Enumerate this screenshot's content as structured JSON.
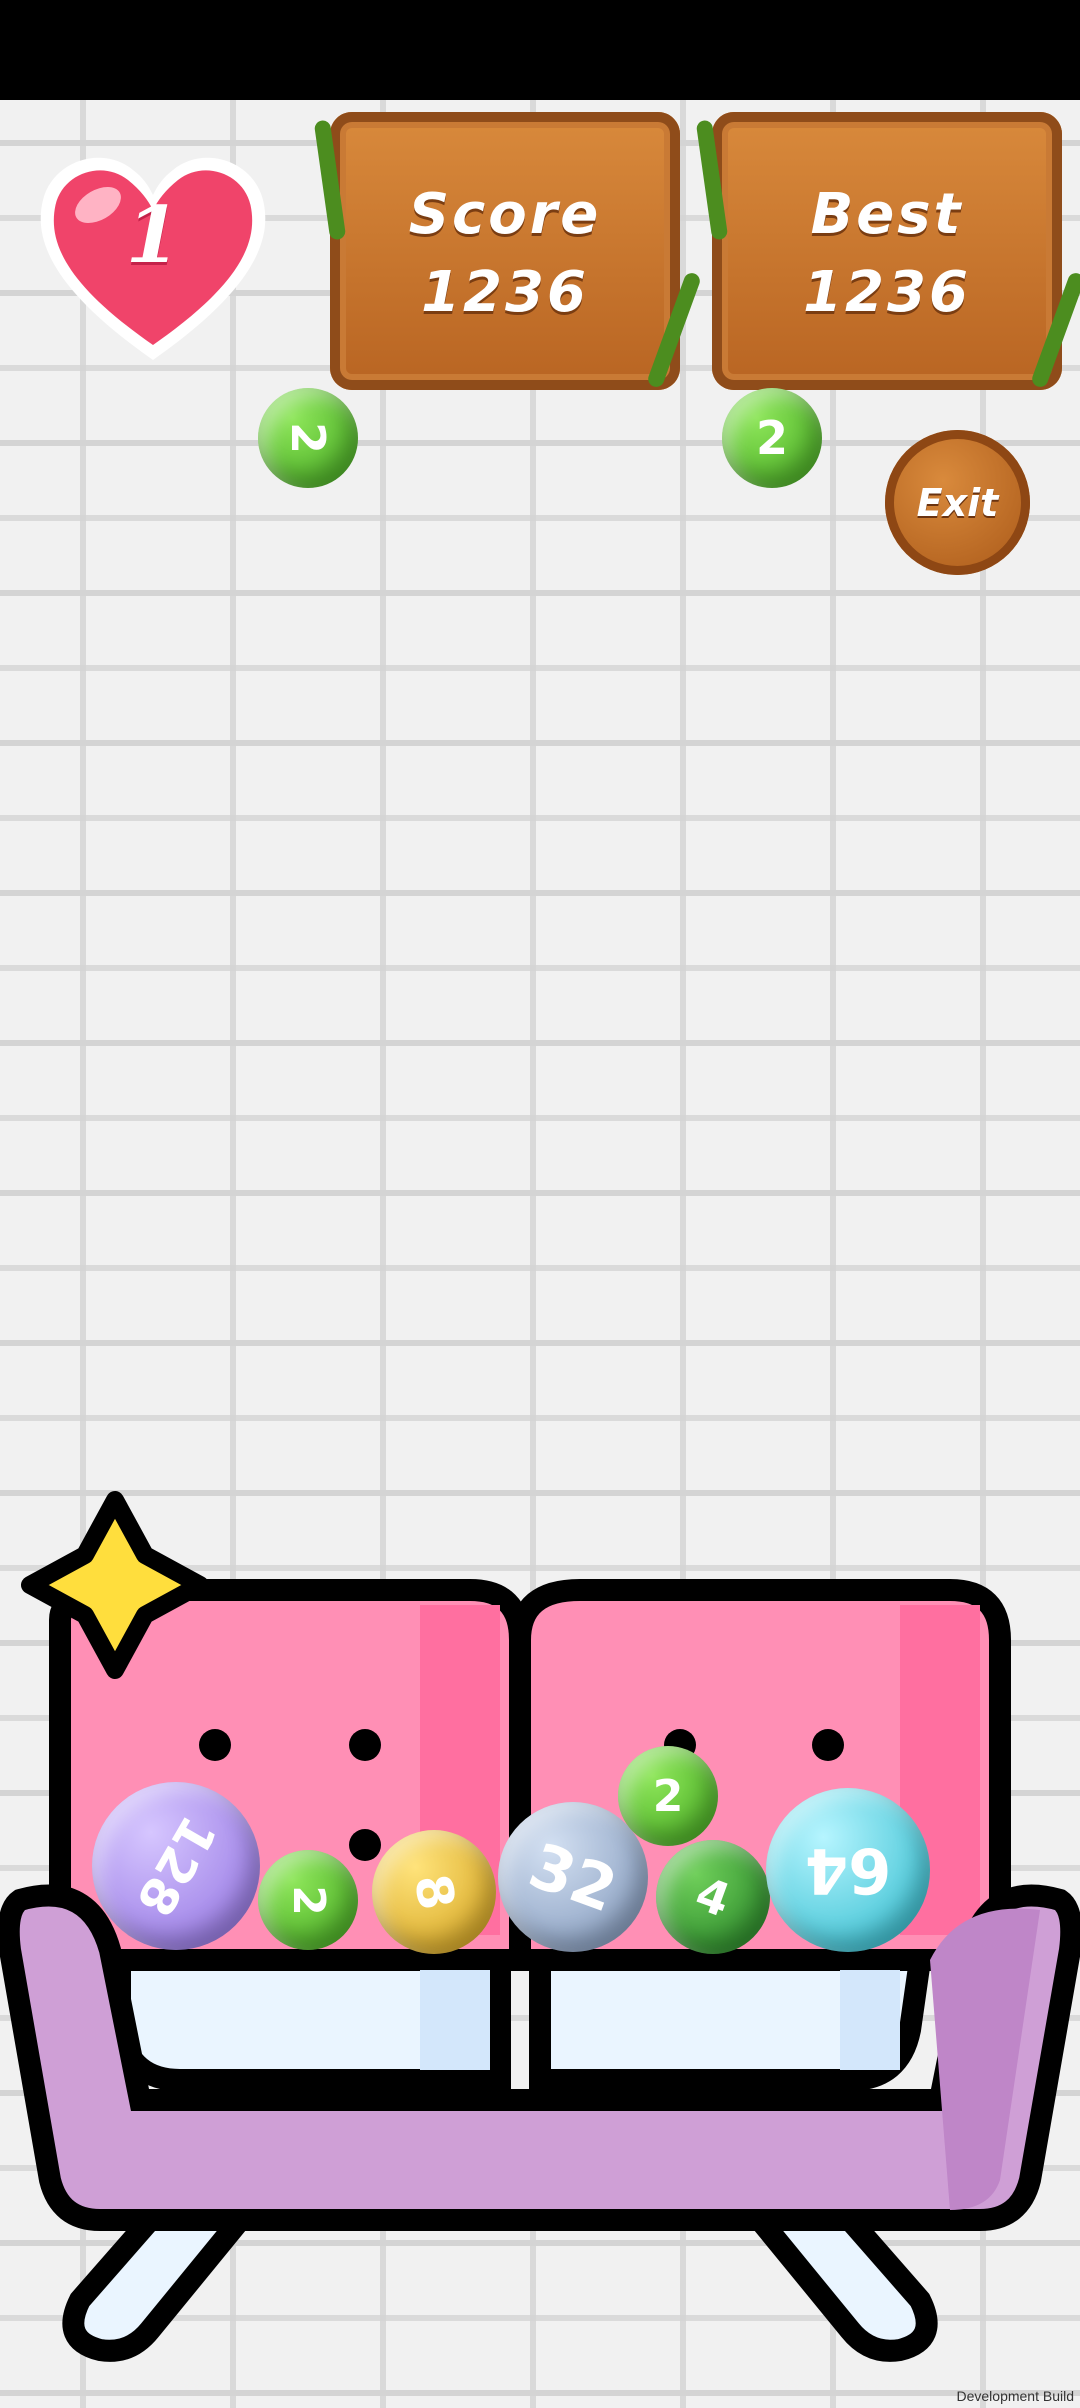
{
  "status_bar": {
    "background": "#000000"
  },
  "hud": {
    "lives": {
      "value": "1",
      "icon": "heart-icon",
      "color": "#f0446a"
    },
    "score": {
      "label": "Score",
      "value": "1236"
    },
    "best": {
      "label": "Best",
      "value": "1236"
    },
    "exit_label": "Exit"
  },
  "queue": {
    "current_ball": "2",
    "next_ball": "2"
  },
  "balls": [
    {
      "value": "128",
      "color": "#9a7be6"
    },
    {
      "value": "2",
      "color": "#56c22c"
    },
    {
      "value": "8",
      "color": "#e6b71f"
    },
    {
      "value": "32",
      "color": "#8aa2c6"
    },
    {
      "value": "2",
      "color": "#56c22c"
    },
    {
      "value": "4",
      "color": "#2f9a33"
    },
    {
      "value": "64",
      "color": "#36c8d8"
    }
  ],
  "footer": {
    "build_label": "Development Build"
  }
}
